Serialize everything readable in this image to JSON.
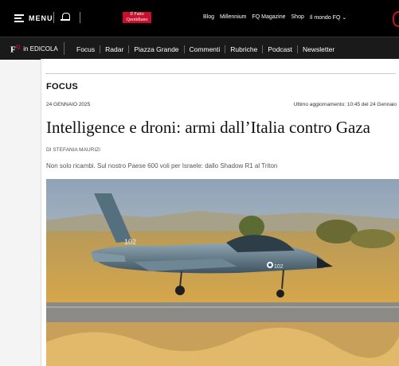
{
  "header": {
    "menu_label": "MENU",
    "logo_line1": "Il Fatto",
    "logo_line2": "Quotidiano",
    "links": [
      "Blog",
      "Millennium",
      "FQ Magazine",
      "Shop",
      "Il mondo FQ"
    ]
  },
  "subnav": {
    "fq_mark": "F",
    "fq_small": "Q",
    "edicola": "in EDICOLA",
    "items": [
      "Focus",
      "Radar",
      "Piazza Grande",
      "Commenti",
      "Rubriche",
      "Podcast",
      "Newsletter"
    ]
  },
  "article": {
    "section": "FOCUS",
    "date": "24 GENNAIO 2025",
    "updated": "Ultimo aggiornamento: 10:45 del 24 Gennaio",
    "headline": "Intelligence e droni: armi dall’Italia contro Gaza",
    "byline_prefix": "DI",
    "author": "STEFANIA MAURIZI",
    "dek": "Non solo ricambi. Sul nostro Paese 600 voli per Israele: dallo Shadow R1 al Triton",
    "photo": {
      "tail_number": "102",
      "nose_number": "102"
    }
  },
  "colors": {
    "brand_red": "#c8102e",
    "topbar_bg": "#000000",
    "subbar_bg": "#1a1a1a"
  }
}
